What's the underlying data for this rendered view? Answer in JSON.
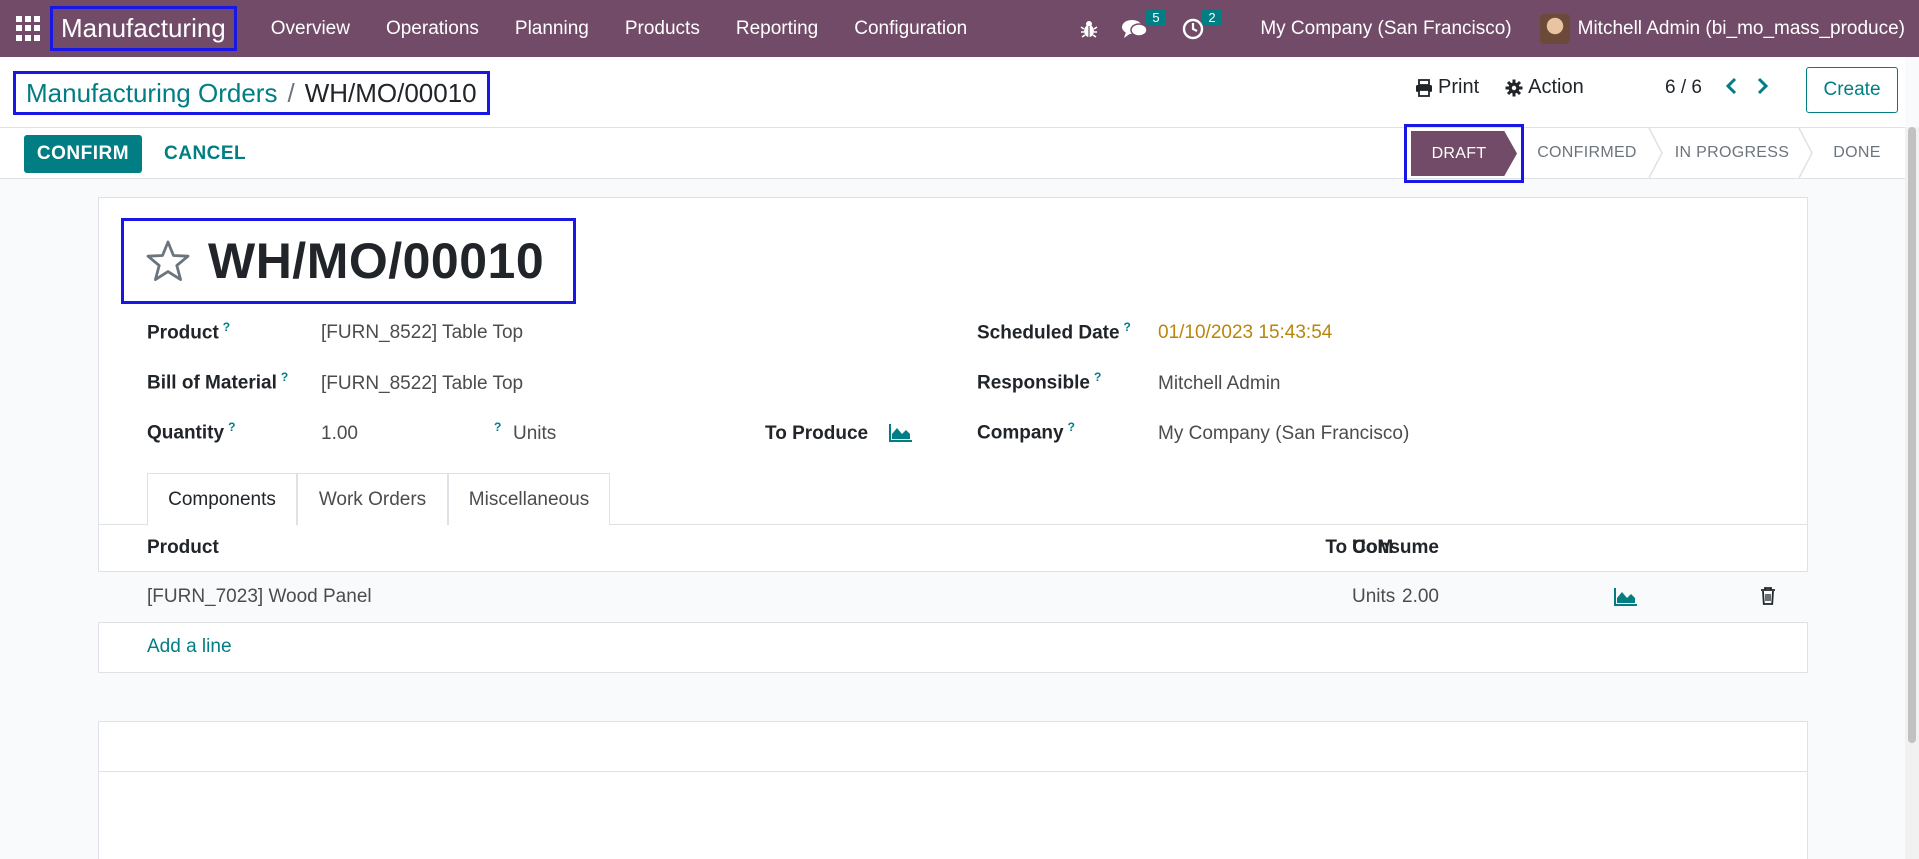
{
  "navbar": {
    "app_name": "Manufacturing",
    "menu": [
      "Overview",
      "Operations",
      "Planning",
      "Products",
      "Reporting",
      "Configuration"
    ],
    "messages_count": "5",
    "activities_count": "2",
    "company": "My Company (San Francisco)",
    "user": "Mitchell Admin (bi_mo_mass_produce)"
  },
  "breadcrumb": {
    "parent": "Manufacturing Orders",
    "separator": "/",
    "current": "WH/MO/00010"
  },
  "actions": {
    "print": "Print",
    "action": "Action",
    "pager": "6 / 6",
    "create": "Create"
  },
  "statusbar": {
    "confirm": "CONFIRM",
    "cancel": "CANCEL",
    "stages": [
      "DRAFT",
      "CONFIRMED",
      "IN PROGRESS",
      "DONE"
    ],
    "active_stage": "DRAFT"
  },
  "form": {
    "title": "WH/MO/00010",
    "fields": {
      "product_label": "Product",
      "product_value": "[FURN_8522] Table Top",
      "bom_label": "Bill of Material",
      "bom_value": "[FURN_8522] Table Top",
      "quantity_label": "Quantity",
      "quantity_value": "1.00",
      "quantity_uom": "Units",
      "to_produce_label": "To Produce",
      "scheduled_label": "Scheduled Date",
      "scheduled_value": "01/10/2023 15:43:54",
      "responsible_label": "Responsible",
      "responsible_value": "Mitchell Admin",
      "company_label": "Company",
      "company_value": "My Company (San Francisco)"
    },
    "help_mark": "?"
  },
  "tabs": [
    "Components",
    "Work Orders",
    "Miscellaneous"
  ],
  "components": {
    "headers": {
      "product": "Product",
      "to_consume": "To Consume",
      "uom": "UoM"
    },
    "rows": [
      {
        "product": "[FURN_7023] Wood Panel",
        "to_consume": "2.00",
        "uom": "Units"
      }
    ],
    "add_line": "Add a line"
  },
  "colors": {
    "navbar": "#714b67",
    "accent": "#017e84",
    "date": "#b8860b",
    "highlight_box": "#1a17e6"
  }
}
